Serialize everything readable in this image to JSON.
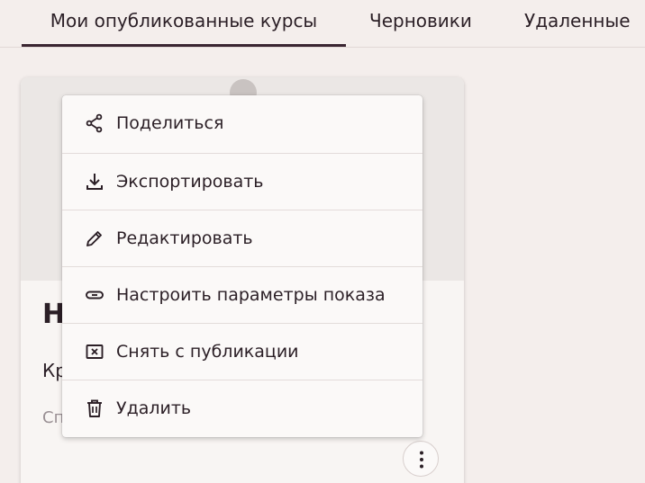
{
  "tabs": [
    {
      "label": "Мои опубликованные курсы",
      "active": true
    },
    {
      "label": "Черновики",
      "active": false
    },
    {
      "label": "Удаленные",
      "active": false
    }
  ],
  "card": {
    "title_partial": "Н",
    "description_partial": "Кр",
    "meta_partial": "Сп"
  },
  "menu": {
    "items": [
      {
        "label": "Поделиться",
        "icon": "share-icon"
      },
      {
        "label": "Экспортировать",
        "icon": "download-icon"
      },
      {
        "label": "Редактировать",
        "icon": "pencil-icon"
      },
      {
        "label": "Настроить параметры показа",
        "icon": "link-icon"
      },
      {
        "label": "Снять с публикации",
        "icon": "close-box-icon"
      },
      {
        "label": "Удалить",
        "icon": "trash-icon"
      }
    ]
  },
  "more_button": {
    "icon": "more-vertical-icon"
  },
  "colors": {
    "background": "#f4eeec",
    "text": "#2b1f26",
    "active_underline": "#3a2531",
    "card": "#f8f5f3",
    "menu": "#fbf9f8"
  }
}
